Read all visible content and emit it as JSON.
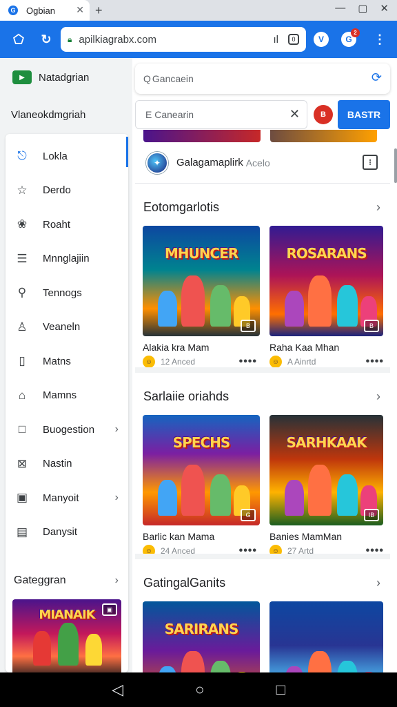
{
  "browser": {
    "tab_title": "Ogbian",
    "tab_favicon": "G",
    "url": "apilkiagrabx.com",
    "omnibox_action": "ıl",
    "window_controls": [
      "minimize-icon",
      "maximize-icon",
      "close-icon"
    ],
    "ext_badge": "2"
  },
  "sidebar": {
    "brand": "Natadgrian",
    "subtitle": "Vlaneokdmgriah",
    "items": [
      {
        "label": "Lokla",
        "icon": "app-icon",
        "glyph": "⎋",
        "active": true
      },
      {
        "label": "Derdo",
        "icon": "star-icon",
        "glyph": "☆"
      },
      {
        "label": "Roaht",
        "icon": "blob-icon",
        "glyph": "❀"
      },
      {
        "label": "Mnnglajiin",
        "icon": "list-icon",
        "glyph": "☰"
      },
      {
        "label": "Tennogs",
        "icon": "search-icon",
        "glyph": "⚲"
      },
      {
        "label": "Veaneln",
        "icon": "person-icon",
        "glyph": "♙"
      },
      {
        "label": "Matns",
        "icon": "file-icon",
        "glyph": "▯"
      },
      {
        "label": "Mamns",
        "icon": "home-icon",
        "glyph": "⌂"
      },
      {
        "label": "Buogestion",
        "icon": "square-icon",
        "glyph": "□",
        "chevron": true
      },
      {
        "label": "Nastin",
        "icon": "image-icon",
        "glyph": "⊠"
      },
      {
        "label": "Manyoit",
        "icon": "window-icon",
        "glyph": "▣",
        "chevron": true
      },
      {
        "label": "Danysit",
        "icon": "calendar-icon",
        "glyph": "▤"
      }
    ],
    "category_heading": "Gateggran",
    "category_thumb_title": "MIANAIK"
  },
  "search": {
    "primary_placeholder": "Gancaein",
    "secondary_placeholder": "E Canearin",
    "red_button": "B",
    "blue_button": "BASTR"
  },
  "selected": {
    "name": "Galagamaplirk",
    "sub": "Acelo",
    "avatar": "✦"
  },
  "sections": [
    {
      "title": "Eotomgarlotis",
      "cards": [
        {
          "name": "Alakia kra Mam",
          "meta": "12 Anced",
          "art": "MHUNCER",
          "badge": "B"
        },
        {
          "name": "Raha Kaa Mhan",
          "meta": "A Ainrtd",
          "art": "ROSARANS",
          "badge": "B"
        }
      ]
    },
    {
      "title": "Sarlaiie oriahds",
      "cards": [
        {
          "name": "Barlic kan Mama",
          "meta": "24 Anced",
          "art": "SPECHS",
          "badge": "G"
        },
        {
          "name": "Banies MamMan",
          "meta": "27 Artd",
          "art": "SARHKAAK",
          "badge": "IB"
        }
      ]
    },
    {
      "title": "GatingalGanits",
      "cards": [
        {
          "name": "",
          "meta": "",
          "art": "SARIRANS",
          "badge": ""
        },
        {
          "name": "",
          "meta": "",
          "art": "",
          "badge": ""
        }
      ]
    }
  ],
  "colors": {
    "accent": "#1a73e8",
    "toolbar": "#1a73e8",
    "danger": "#d93025",
    "brand_green": "#1e8e3e"
  },
  "android_nav": [
    "back-icon",
    "home-icon",
    "recents-icon"
  ]
}
